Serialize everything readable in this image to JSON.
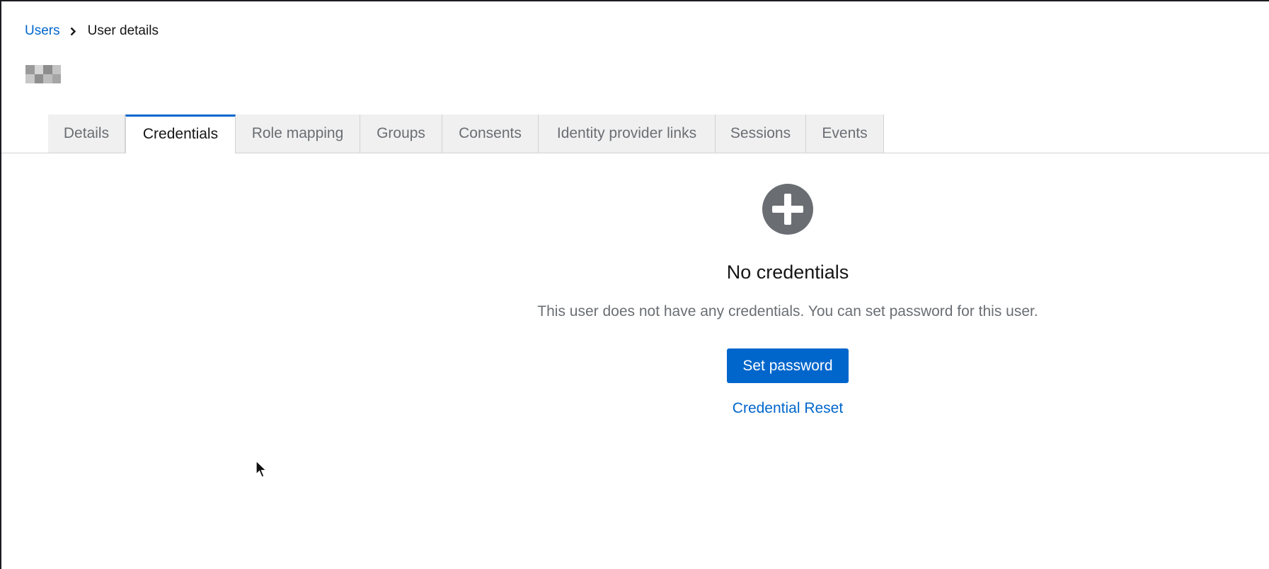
{
  "breadcrumb": {
    "parent": "Users",
    "current": "User details"
  },
  "tabs": [
    {
      "label": "Details",
      "active": false
    },
    {
      "label": "Credentials",
      "active": true
    },
    {
      "label": "Role mapping",
      "active": false
    },
    {
      "label": "Groups",
      "active": false
    },
    {
      "label": "Consents",
      "active": false
    },
    {
      "label": "Identity provider links",
      "active": false
    },
    {
      "label": "Sessions",
      "active": false
    },
    {
      "label": "Events",
      "active": false
    }
  ],
  "empty_state": {
    "icon": "plus-circle-icon",
    "title": "No credentials",
    "body": "This user does not have any credentials. You can set password for this user.",
    "primary_action": "Set password",
    "secondary_action": "Credential Reset"
  },
  "colors": {
    "link": "#0066cc",
    "primary": "#0066cc",
    "icon": "#6a6e73",
    "tab_bg": "#f0f0f0"
  }
}
